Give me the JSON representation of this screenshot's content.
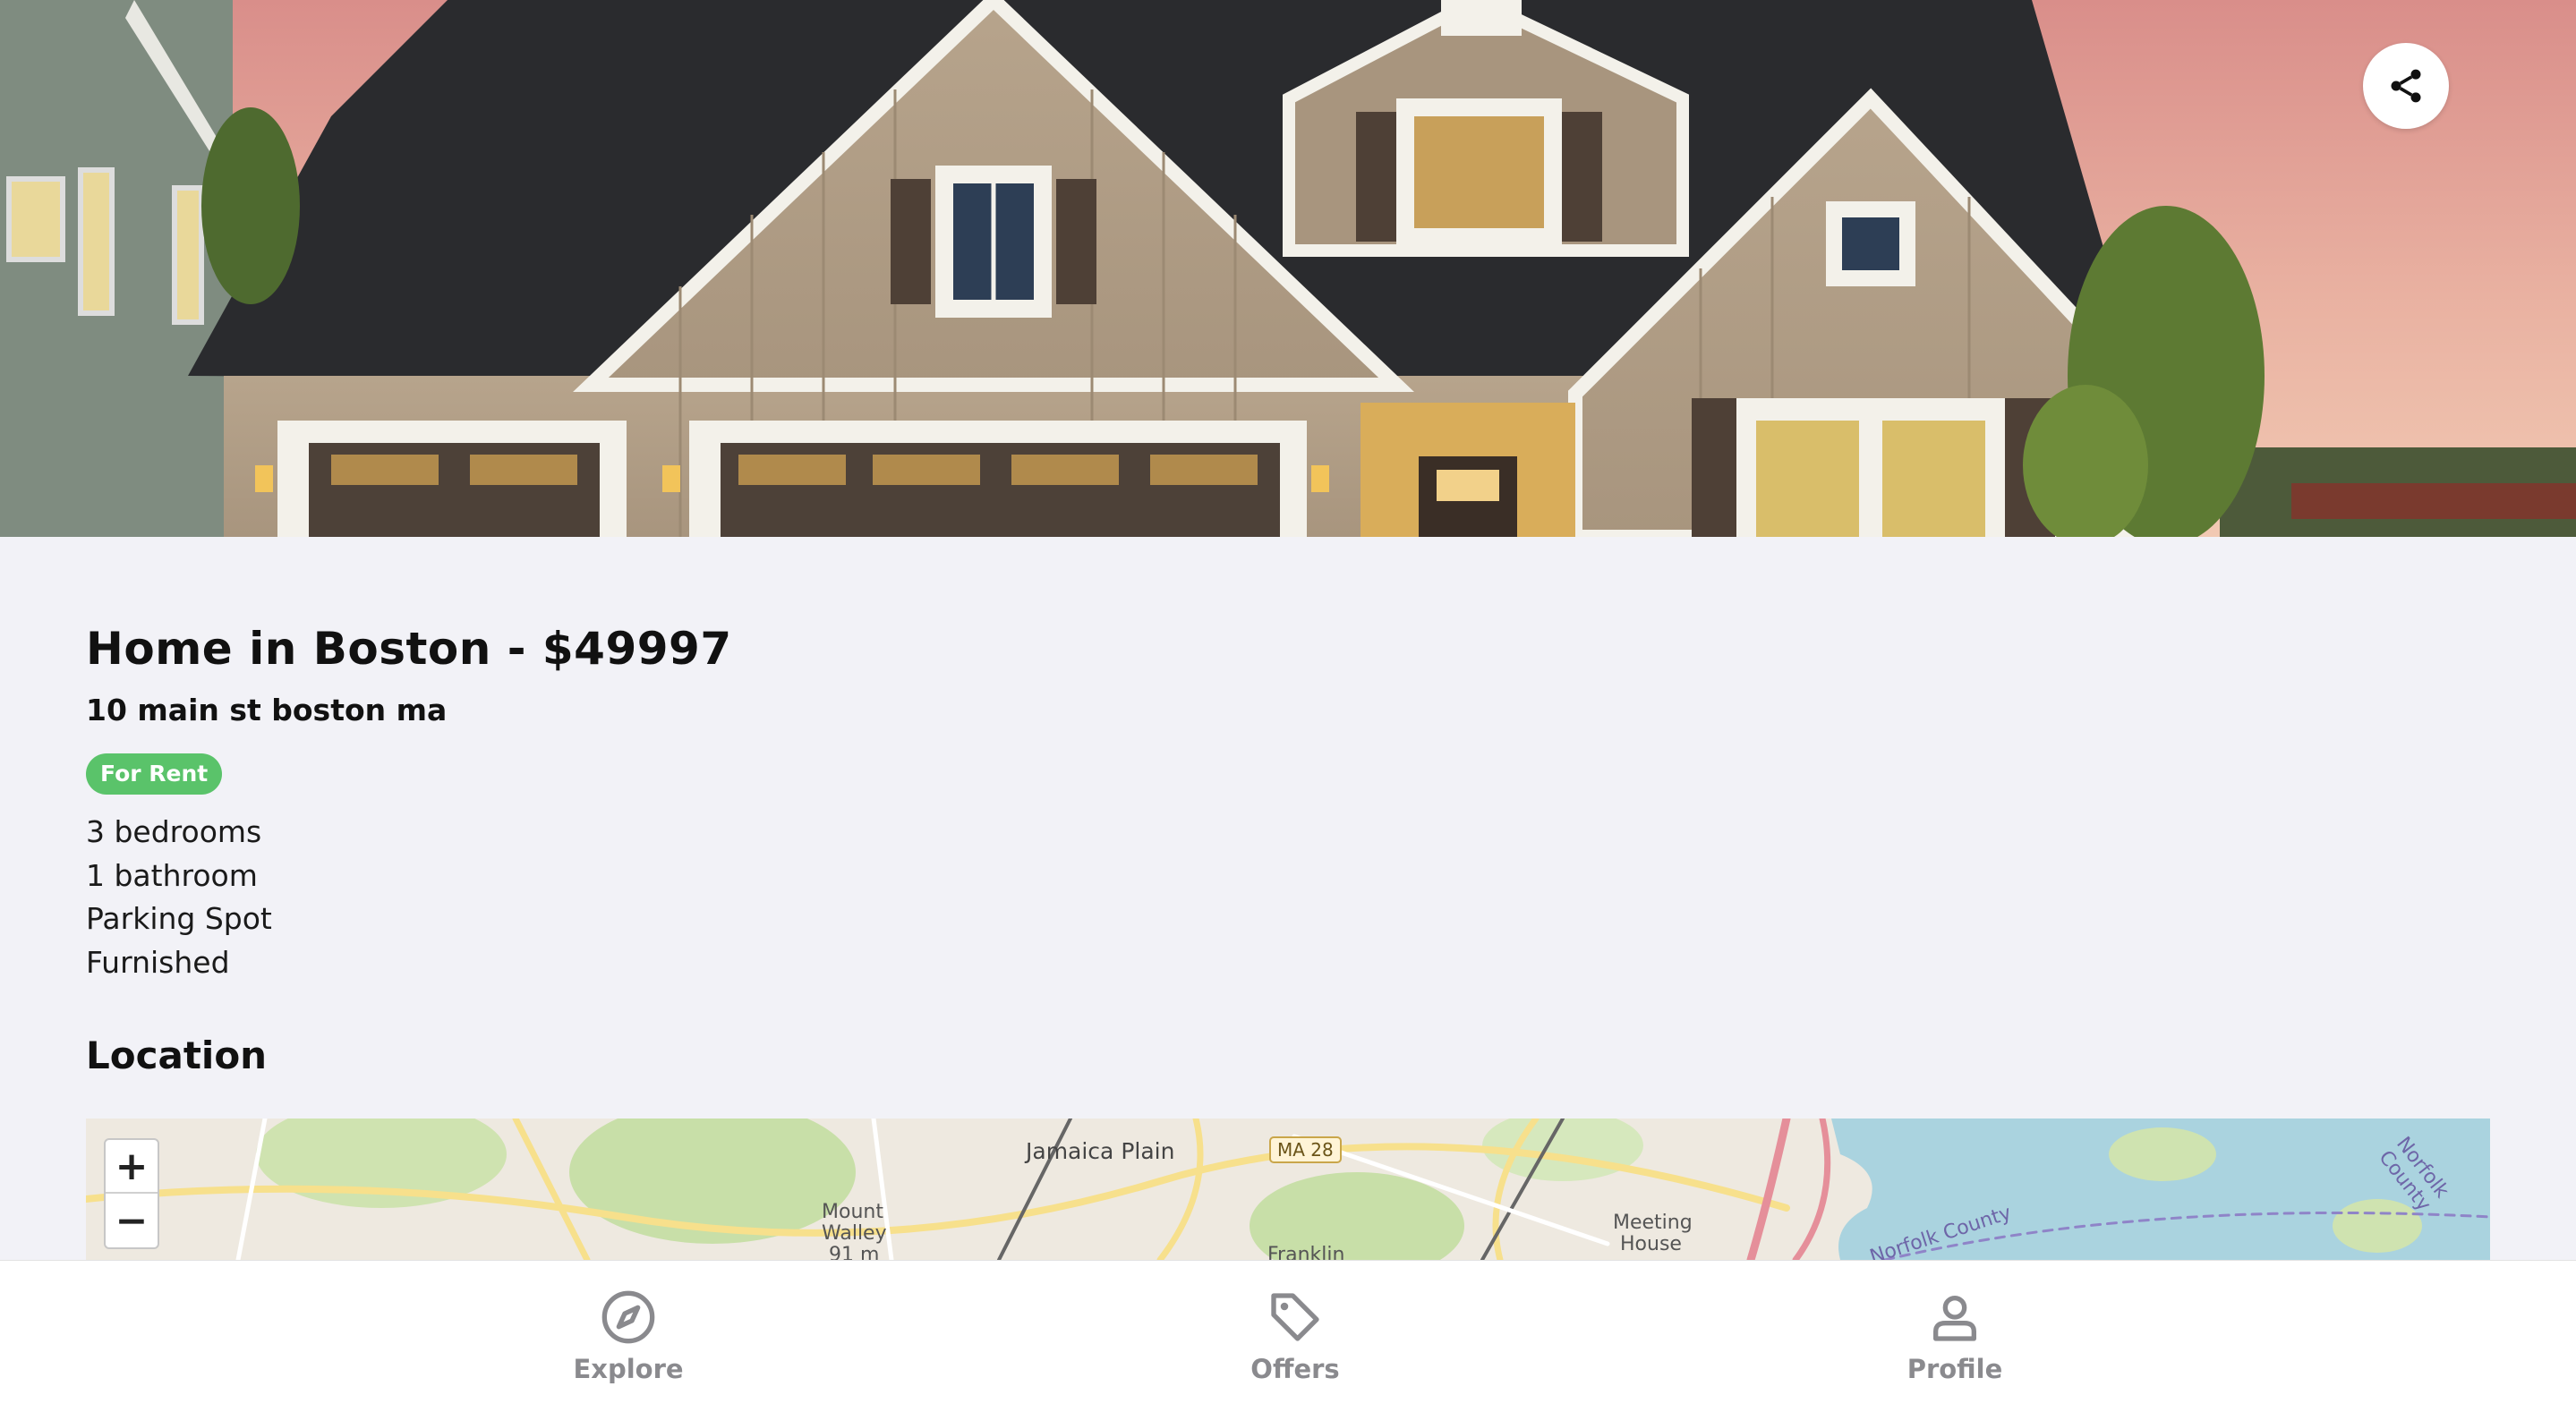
{
  "listing": {
    "title": "Home in Boston - $49997",
    "address": "10 main st boston ma",
    "status": "For Rent",
    "features": [
      "3 bedrooms",
      "1 bathroom",
      "Parking Spot",
      "Furnished"
    ]
  },
  "location": {
    "section_title": "Location",
    "map": {
      "zoom_in": "+",
      "zoom_out": "−",
      "labels": [
        "Jamaica Plain",
        "Mount",
        "Walley",
        "91 m",
        "Meeting",
        "House",
        "Franklin",
        "Norfolk County",
        "Norfolk County"
      ],
      "route_shield": "MA 28"
    }
  },
  "tabbar": {
    "tabs": [
      {
        "label": "Explore",
        "icon": "compass-icon"
      },
      {
        "label": "Offers",
        "icon": "tag-icon"
      },
      {
        "label": "Profile",
        "icon": "person-icon"
      }
    ]
  },
  "hero": {
    "share_icon": "share-icon"
  },
  "colors": {
    "accent_green": "#5ac36a",
    "tab_inactive": "#8a8a8e",
    "background": "#f2f2f7"
  }
}
